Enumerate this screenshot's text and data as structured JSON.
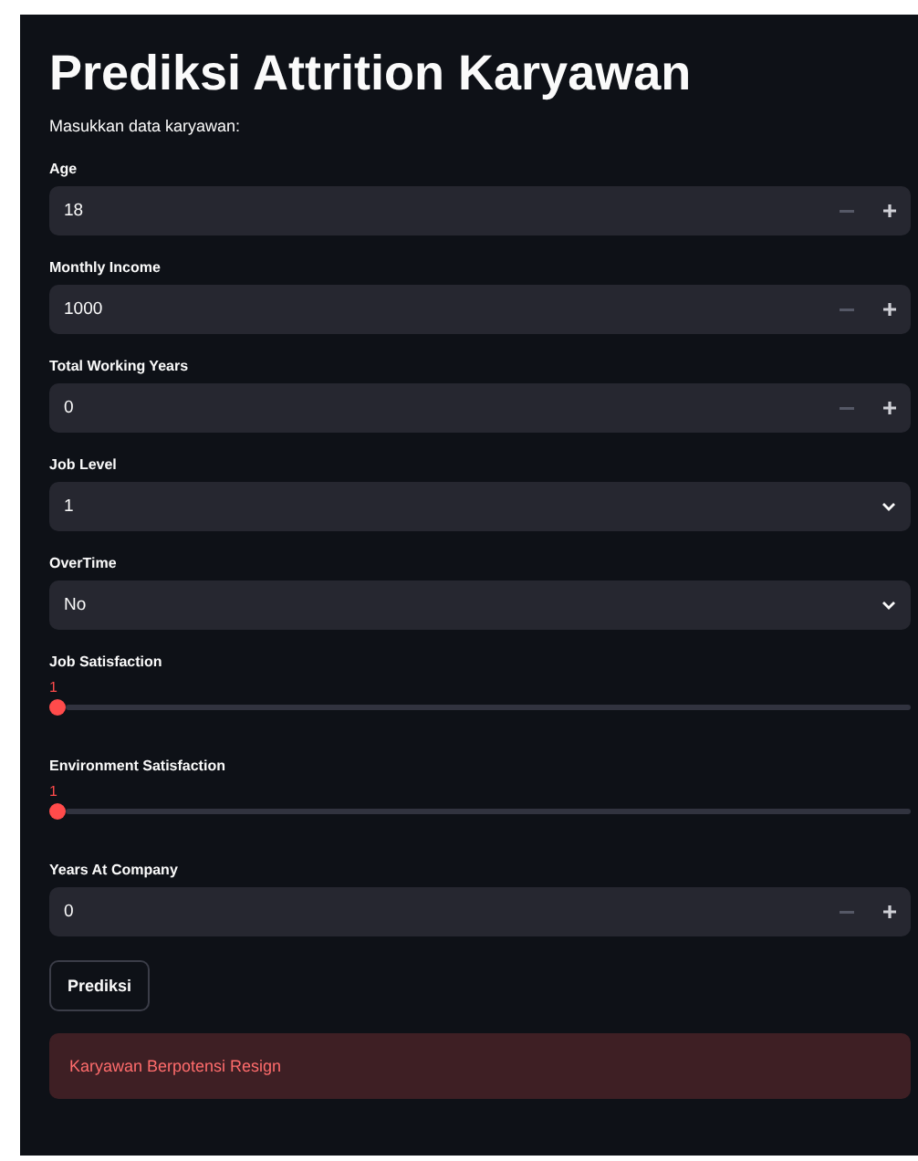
{
  "title": "Prediksi Attrition Karyawan",
  "subtitle": "Masukkan data karyawan:",
  "fields": [
    {
      "kind": "number",
      "label": "Age",
      "value": "18"
    },
    {
      "kind": "number",
      "label": "Monthly Income",
      "value": "1000"
    },
    {
      "kind": "number",
      "label": "Total Working Years",
      "value": "0"
    },
    {
      "kind": "select",
      "label": "Job Level",
      "value": "1"
    },
    {
      "kind": "select",
      "label": "OverTime",
      "value": "No"
    },
    {
      "kind": "slider",
      "label": "Job Satisfaction",
      "value": "1",
      "level": 0
    },
    {
      "kind": "slider",
      "label": "Environment Satisfaction",
      "value": "1",
      "level": 0
    },
    {
      "kind": "number",
      "label": "Years At Company",
      "value": "0"
    }
  ],
  "button": "Prediksi",
  "alert": "Karyawan Berpotensi Resign"
}
